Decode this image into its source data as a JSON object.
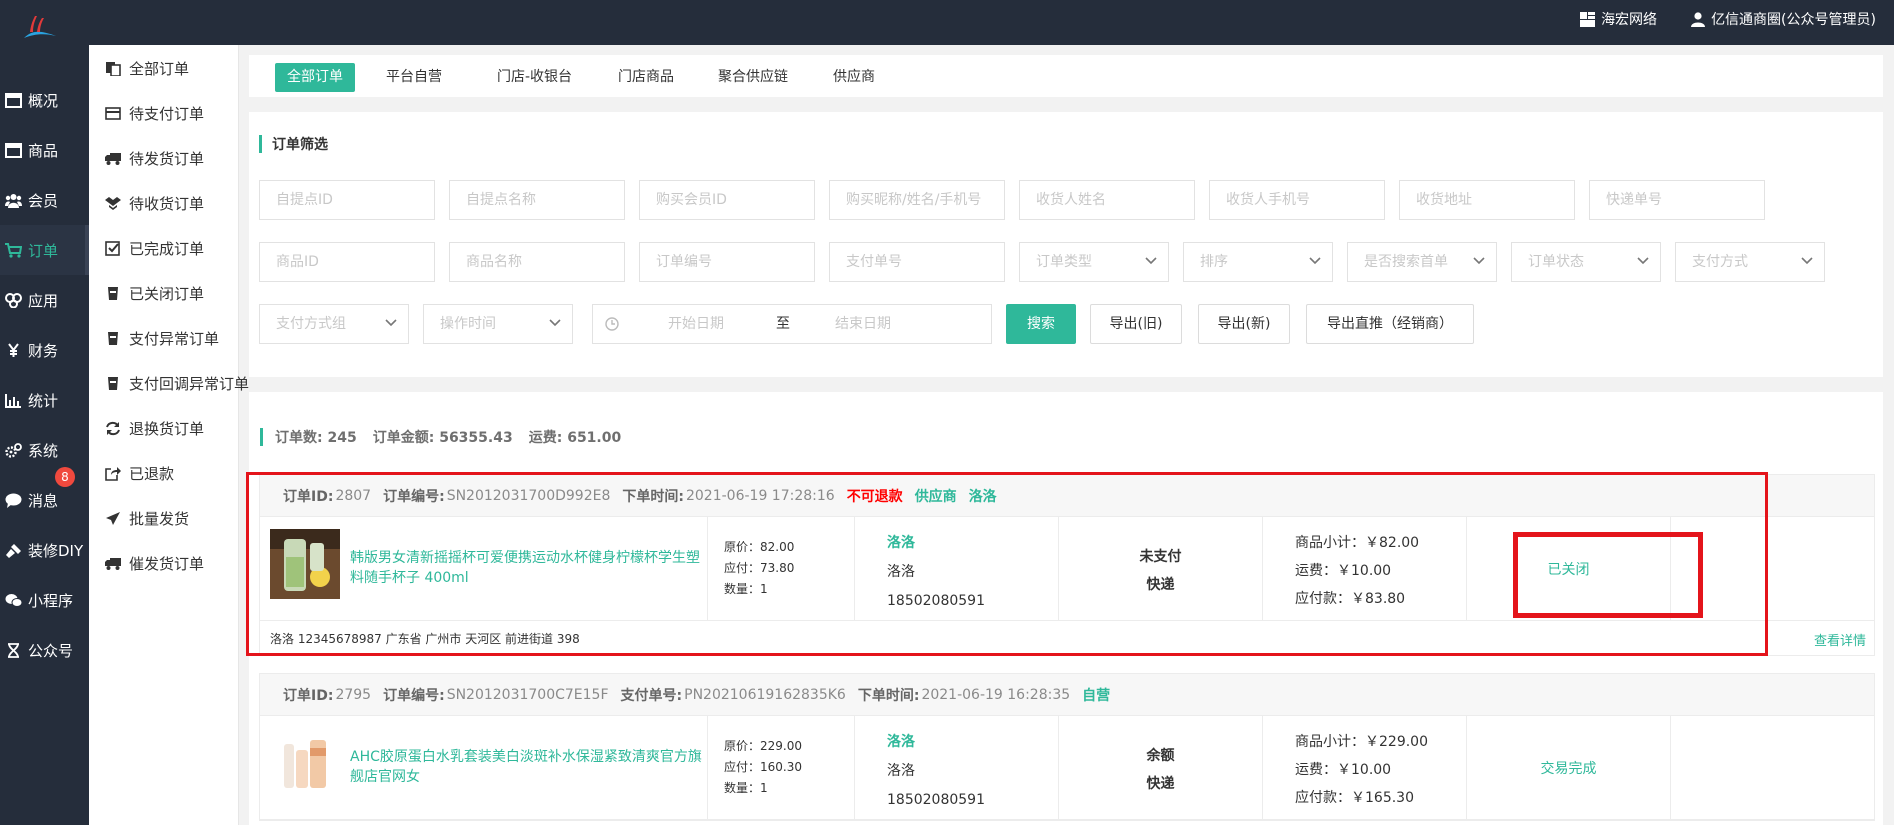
{
  "header": {
    "company": "海宏网络",
    "user": "亿信通商圈(公众号管理员)"
  },
  "nav": [
    {
      "label": "概况",
      "icon": "dashboard-icon"
    },
    {
      "label": "商品",
      "icon": "goods-icon"
    },
    {
      "label": "会员",
      "icon": "users-icon"
    },
    {
      "label": "订单",
      "icon": "cart-icon",
      "active": true
    },
    {
      "label": "应用",
      "icon": "apps-icon"
    },
    {
      "label": "财务",
      "icon": "yen-icon"
    },
    {
      "label": "统计",
      "icon": "bar-chart-icon"
    },
    {
      "label": "系统",
      "icon": "gears-icon"
    },
    {
      "label": "消息",
      "icon": "chat-icon",
      "badge": "8"
    },
    {
      "label": "装修DIY",
      "icon": "brush-icon"
    },
    {
      "label": "小程序",
      "icon": "wechat-icon"
    },
    {
      "label": "公众号",
      "icon": "hourglass-icon"
    }
  ],
  "subnav": [
    {
      "label": "全部订单",
      "icon": "copy-icon"
    },
    {
      "label": "待支付订单",
      "icon": "credit-card-icon"
    },
    {
      "label": "待发货订单",
      "icon": "truck-icon"
    },
    {
      "label": "待收货订单",
      "icon": "dropbox-icon"
    },
    {
      "label": "已完成订单",
      "icon": "check-square-icon"
    },
    {
      "label": "已关闭订单",
      "icon": "cup-icon"
    },
    {
      "label": "支付异常订单",
      "icon": "cup-icon"
    },
    {
      "label": "支付回调异常订单",
      "icon": "cup-icon"
    },
    {
      "label": "退换货订单",
      "icon": "refresh-icon"
    },
    {
      "label": "已退款",
      "icon": "share-icon"
    },
    {
      "label": "批量发货",
      "icon": "paper-plane-icon"
    },
    {
      "label": "催发货订单",
      "icon": "truck-icon"
    }
  ],
  "tabs": [
    "全部订单",
    "平台自营",
    "门店-收银台",
    "门店商品",
    "聚合供应链",
    "供应商"
  ],
  "filter": {
    "title": "订单筛选",
    "row1": [
      "自提点ID",
      "自提点名称",
      "购买会员ID",
      "购买昵称/姓名/手机号",
      "收货人姓名",
      "收货人手机号",
      "收货地址",
      "快递单号"
    ],
    "row2_inputs": [
      "商品ID",
      "商品名称",
      "订单编号",
      "支付单号"
    ],
    "row2_selects": [
      "订单类型",
      "排序",
      "是否搜索首单",
      "订单状态",
      "支付方式"
    ],
    "row3_selects": [
      "支付方式组",
      "操作时间"
    ],
    "date_start": "开始日期",
    "date_sep": "至",
    "date_end": "结束日期",
    "buttons": [
      "搜索",
      "导出(旧)",
      "导出(新)",
      "导出直推（经销商）"
    ]
  },
  "summary": {
    "count_label": "订单数:",
    "count": "245",
    "amount_label": "订单金额:",
    "amount": "56355.43",
    "freight_label": "运费:",
    "freight": "651.00"
  },
  "orders": [
    {
      "id_label": "订单ID:",
      "id": "2807",
      "sn_label": "订单编号:",
      "sn": "SN2012031700D992E8",
      "time_label": "下单时间:",
      "time": "2021-06-19 17:28:16",
      "tag_red": "不可退款",
      "tags_green": [
        "供应商",
        "洛洛"
      ],
      "product": "韩版男女清新摇摇杯可爱便携运动水杯健身柠檬杯学生塑料随手杯子 400ml",
      "orig_price": "原价：82.00",
      "due_price": "应付：73.80",
      "qty": "数量：1",
      "buyer_nick": "洛洛",
      "buyer_name": "洛洛",
      "buyer_phone": "18502080591",
      "pay_status": "未支付",
      "delivery": "快递",
      "subtotal": "商品小计：￥82.00",
      "freight": "运费：￥10.00",
      "payable": "应付款：￥83.80",
      "status": "已关闭",
      "address": "洛洛   12345678987   广东省 广州市 天河区 前进街道 398",
      "detail": "查看详情"
    },
    {
      "id_label": "订单ID:",
      "id": "2795",
      "sn_label": "订单编号:",
      "sn": "SN2012031700C7E15F",
      "payno_label": "支付单号:",
      "payno": "PN20210619162835K6",
      "time_label": "下单时间:",
      "time": "2021-06-19 16:28:35",
      "tags_green": [
        "自营"
      ],
      "product": "AHC胶原蛋白水乳套装美白淡斑补水保湿紧致清爽官方旗舰店官网女",
      "orig_price": "原价：229.00",
      "due_price": "应付：160.30",
      "qty": "数量：1",
      "buyer_nick": "洛洛",
      "buyer_name": "洛洛",
      "buyer_phone": "18502080591",
      "pay_status": "余额",
      "delivery": "快递",
      "subtotal": "商品小计：￥229.00",
      "freight": "运费：￥10.00",
      "payable": "应付款：￥165.30",
      "status": "交易完成"
    }
  ],
  "colors": {
    "accent": "#2fb89a",
    "sidebar": "#252d3b",
    "alert": "#f00",
    "highlight_box": "#e4141b"
  }
}
